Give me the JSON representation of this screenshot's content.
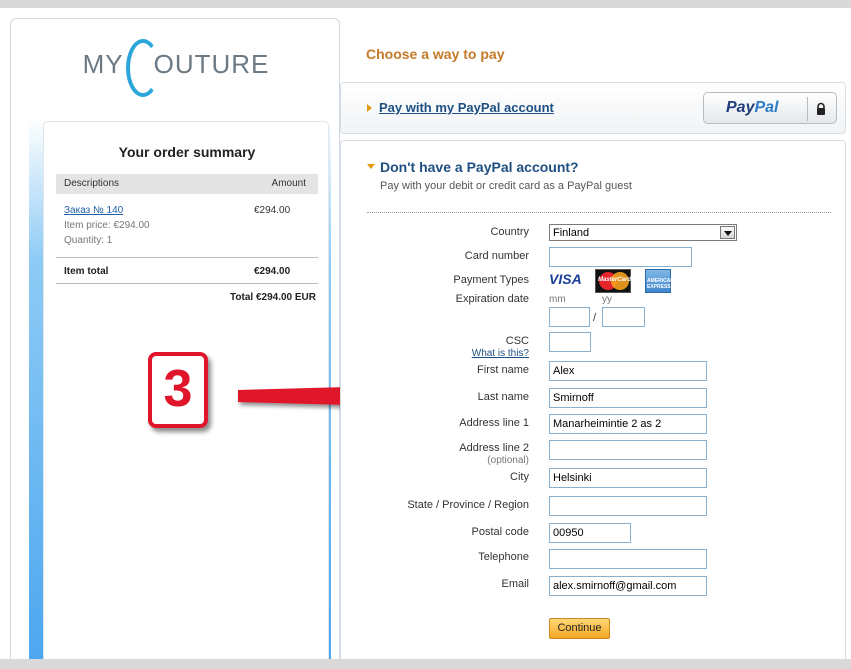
{
  "brand": {
    "logo_prefix": "MY",
    "logo_suffix": "OUTURE",
    "accent_color": "#2aa6da"
  },
  "order_summary": {
    "title": "Your order summary",
    "col_description": "Descriptions",
    "col_amount": "Amount",
    "item": {
      "name": "Заказ № 140",
      "amount": "€294.00",
      "price_line": "Item price: €294.00",
      "quantity_line": "Quantity: 1"
    },
    "item_total_label": "Item total",
    "item_total_value": "€294.00",
    "total_line": "Total €294.00 EUR"
  },
  "annotation": {
    "step_number": "3",
    "color": "#e0142a"
  },
  "payment": {
    "choose_title": "Choose a way to pay",
    "paypal_account_link": "Pay with my PayPal account",
    "paypal_badge_pay": "Pay",
    "paypal_badge_pal": "Pal",
    "guest_title": "Don't have a PayPal account?",
    "guest_subtitle": "Pay with your debit or credit card as a PayPal guest"
  },
  "form": {
    "country_label": "Country",
    "country_value": "Finland",
    "card_number_label": "Card number",
    "card_number_value": "",
    "payment_types_label": "Payment Types",
    "card_brand_visa": "VISA",
    "card_brand_mc": "MasterCard",
    "card_brand_amex": "AMERICAN EXPRESS",
    "expiration_label": "Expiration date",
    "mm_hint": "mm",
    "yy_hint": "yy",
    "exp_mm_value": "",
    "exp_yy_value": "",
    "csc_label": "CSC",
    "csc_help": "What is this?",
    "csc_value": "",
    "first_name_label": "First name",
    "first_name_value": "Alex",
    "last_name_label": "Last name",
    "last_name_value": "Smirnoff",
    "address1_label": "Address line 1",
    "address1_value": "Manarheimintie 2 as 2",
    "address2_label": "Address line 2",
    "address2_optional": "(optional)",
    "address2_value": "",
    "city_label": "City",
    "city_value": "Helsinki",
    "state_label": "State / Province / Region",
    "state_value": "",
    "postal_label": "Postal code",
    "postal_value": "00950",
    "telephone_label": "Telephone",
    "telephone_value": "",
    "email_label": "Email",
    "email_value": "alex.smirnoff@gmail.com",
    "continue_label": "Continue"
  }
}
